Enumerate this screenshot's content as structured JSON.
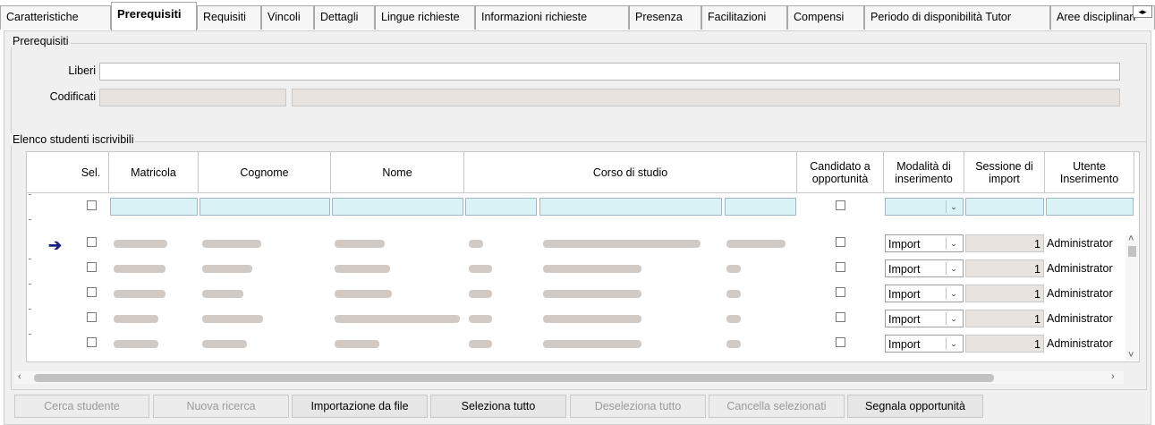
{
  "tabs": [
    {
      "label": "Caratteristiche",
      "active": false
    },
    {
      "label": "Prerequisiti",
      "active": true
    },
    {
      "label": "Requisiti",
      "active": false
    },
    {
      "label": "Vincoli",
      "active": false
    },
    {
      "label": "Dettagli",
      "active": false
    },
    {
      "label": "Lingue richieste",
      "active": false
    },
    {
      "label": "Informazioni richieste",
      "active": false
    },
    {
      "label": "Presenza",
      "active": false
    },
    {
      "label": "Facilitazioni",
      "active": false
    },
    {
      "label": "Compensi",
      "active": false
    },
    {
      "label": "Periodo di disponibilità Tutor",
      "active": false
    },
    {
      "label": "Aree disciplinari",
      "active": false
    }
  ],
  "prerequisiti": {
    "legend": "Prerequisiti",
    "liberi_label": "Liberi",
    "liberi_value": "",
    "codificati_label": "Codificati",
    "codificati_code": "",
    "codificati_desc": ""
  },
  "elenco": {
    "legend": "Elenco studenti iscrivibili",
    "columns": {
      "sel": "Sel.",
      "matricola": "Matricola",
      "cognome": "Cognome",
      "nome": "Nome",
      "corso": "Corso di studio",
      "candidato": "Candidato a opportunità",
      "modalita": "Modalità di inserimento",
      "sessione": "Sessione di import",
      "utente": "Utente Inserimento"
    },
    "rows": [
      {
        "modalita": "Import",
        "sessione": "1",
        "utente": "Administrator",
        "current": true
      },
      {
        "modalita": "Import",
        "sessione": "1",
        "utente": "Administrator",
        "current": false
      },
      {
        "modalita": "Import",
        "sessione": "1",
        "utente": "Administrator",
        "current": false
      },
      {
        "modalita": "Import",
        "sessione": "1",
        "utente": "Administrator",
        "current": false
      },
      {
        "modalita": "Import",
        "sessione": "1",
        "utente": "Administrator",
        "current": false
      }
    ]
  },
  "buttons": {
    "cerca": "Cerca studente",
    "nuova": "Nuova ricerca",
    "importazione": "Importazione da file",
    "seleziona": "Seleziona tutto",
    "deseleziona": "Deseleziona tutto",
    "cancella": "Cancella selezionati",
    "segnala": "Segnala opportunità"
  },
  "colors": {
    "filter_bg": "#d9f3f7",
    "arrow": "#1a237e",
    "disabled_input": "#e8e3de"
  }
}
